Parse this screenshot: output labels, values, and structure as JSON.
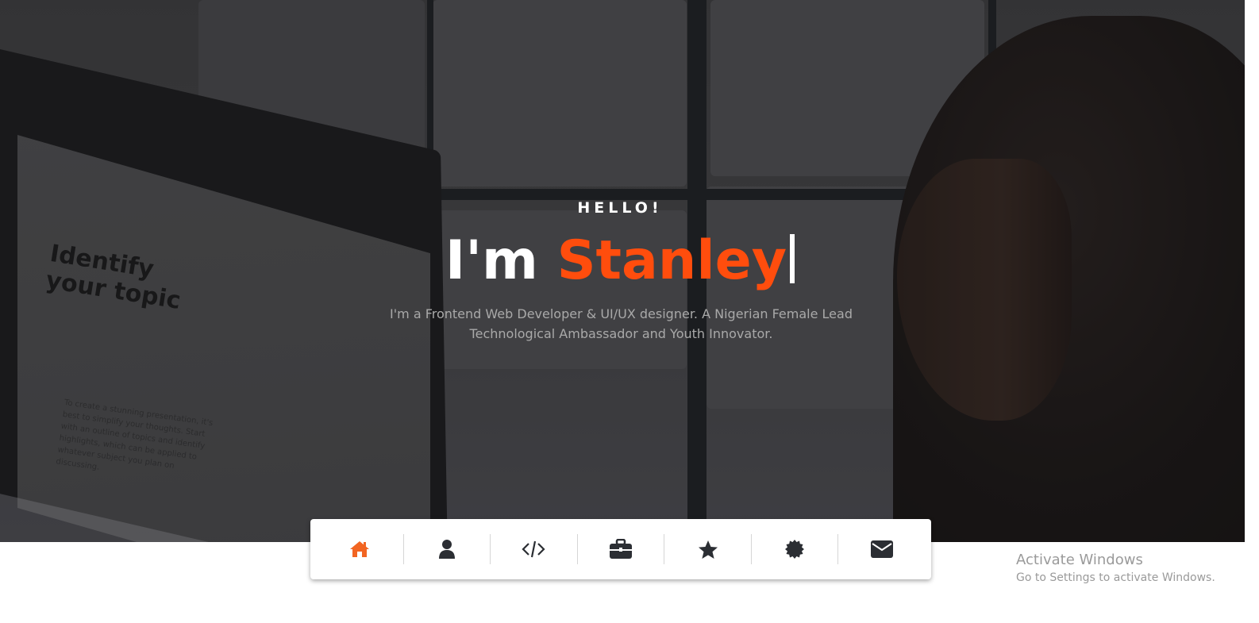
{
  "hero": {
    "greeting": "HELLO!",
    "headline_prefix": "I'm ",
    "headline_name": "Stanley",
    "subtitle": "I'm a Frontend Web Developer & UI/UX designer. A Nigerian Female Lead Technological Ambassador and Youth Innovator.",
    "screen_title": "Identify your topic",
    "screen_body": "To create a stunning presentation, it's best to simplify your thoughts. Start with an outline of topics and identify highlights, which can be applied to whatever subject you plan on discussing."
  },
  "nav": {
    "items": [
      {
        "icon": "home-icon",
        "active": true
      },
      {
        "icon": "user-icon",
        "active": false
      },
      {
        "icon": "code-icon",
        "active": false
      },
      {
        "icon": "briefcase-icon",
        "active": false
      },
      {
        "icon": "star-icon",
        "active": false
      },
      {
        "icon": "certificate-icon",
        "active": false
      },
      {
        "icon": "envelope-icon",
        "active": false
      }
    ]
  },
  "colors": {
    "accent": "#ff4d0d",
    "nav_icon": "#2b2e33",
    "nav_active": "#f26522"
  },
  "watermark": {
    "title": "Activate Windows",
    "subtitle": "Go to Settings to activate Windows."
  }
}
